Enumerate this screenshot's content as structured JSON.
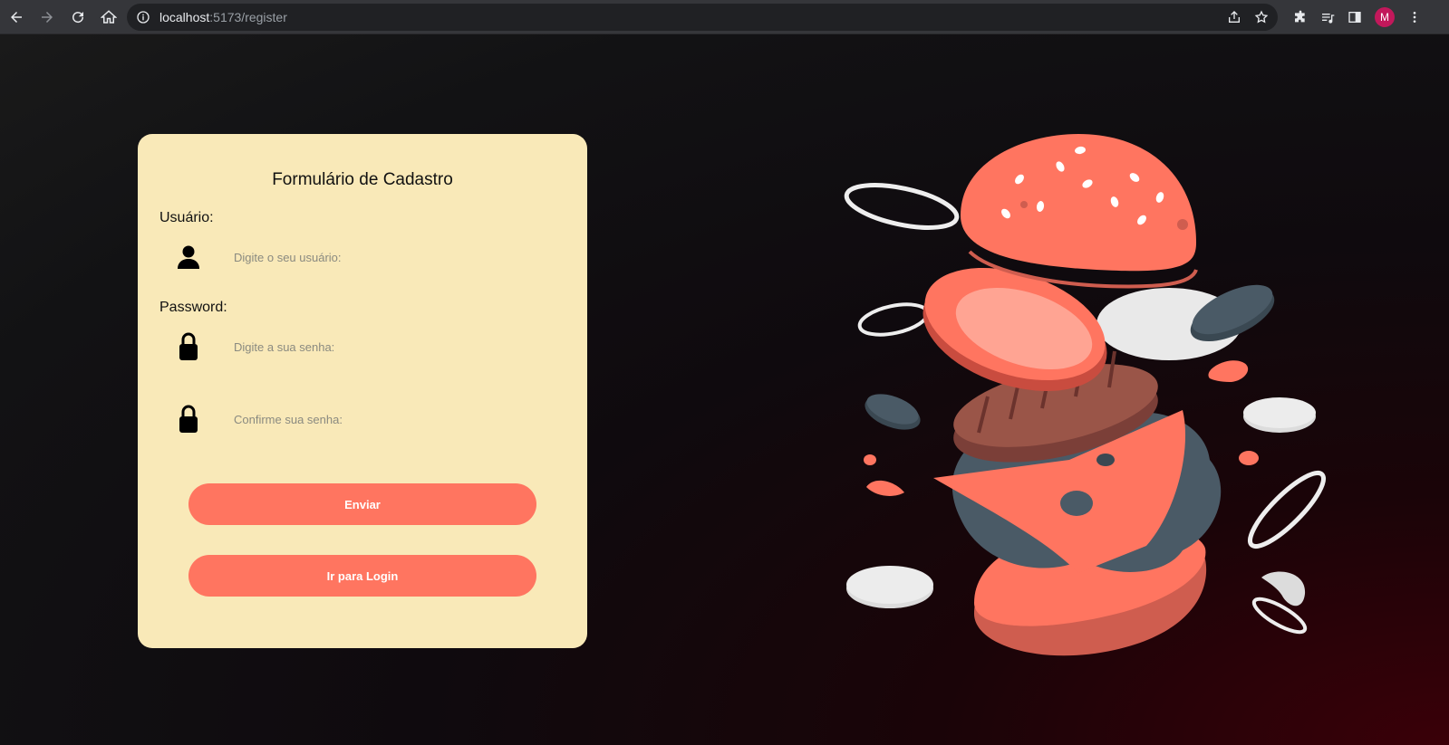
{
  "browser": {
    "url_host": "localhost",
    "url_path": ":5173/register",
    "profile_initial": "M"
  },
  "form": {
    "title": "Formulário de Cadastro",
    "user_label": "Usuário:",
    "user_placeholder": "Digite o seu usuário:",
    "password_label": "Password:",
    "password_placeholder": "Digite a sua senha:",
    "confirm_placeholder": "Confirme sua senha:",
    "submit_label": "Enviar",
    "login_label": "Ir para Login"
  },
  "colors": {
    "card_bg": "#f9e9b8",
    "button": "#ff7560",
    "accent_tomato": "#ff7560",
    "patty": "#8e4c44",
    "lettuce": "#4a5a66"
  },
  "icons": {
    "user": "user-icon",
    "lock": "lock-icon"
  }
}
